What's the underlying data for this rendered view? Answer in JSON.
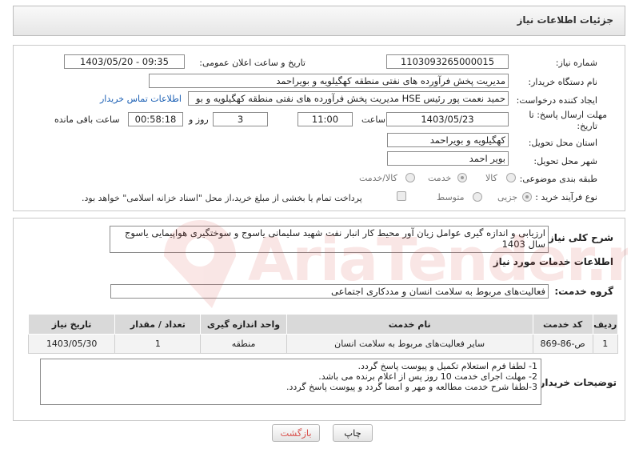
{
  "header": {
    "title": "جزئیات اطلاعات نیاز"
  },
  "fields": {
    "need_number_label": "شماره نیاز:",
    "need_number": "1103093265000015",
    "announce_label": "تاریخ و ساعت اعلان عمومی:",
    "announce_value": "1403/05/20 - 09:35",
    "buyer_org_label": "نام دستگاه خریدار:",
    "buyer_org": "مدیریت پخش فرآورده های نفتی منطقه کهگیلویه و بویراحمد",
    "creator_label": "ایجاد کننده درخواست:",
    "creator": "حمید نعمت پور رئیس HSE مدیریت پخش فرآورده های نفتی منطقه کهگیلویه و بو",
    "contact_link": "اطلاعات تماس خریدار",
    "deadline_label_1": "مهلت ارسال پاسخ: تا",
    "deadline_label_2": "تاریخ:",
    "deadline_date": "1403/05/23",
    "time_label": "ساعت",
    "deadline_time": "11:00",
    "days_value": "3",
    "days_label": "روز و",
    "remaining_time": "00:58:18",
    "remaining_label": "ساعت باقی مانده",
    "province_label": "استان محل تحویل:",
    "province": "کهگیلویه و بویراحمد",
    "city_label": "شهر محل تحویل:",
    "city": "بویر احمد",
    "category_label": "طبقه بندی موضوعی:",
    "category_options": [
      "کالا",
      "خدمت",
      "کالا/خدمت"
    ],
    "process_label": "نوع فرآیند خرید :",
    "process_options": [
      "جزیی",
      "متوسط"
    ],
    "payment_note": "پرداخت تمام یا بخشی از مبلغ خرید،از محل \"اسناد خزانه اسلامی\" خواهد بود."
  },
  "summary": {
    "label": "شرح کلی نیاز:",
    "text": "ارزیابی و اندازه گیری عوامل زیان آور محیط کار انبار نفت شهید سلیمانی یاسوج و سوختگیری هواپیمایی یاسوج سال 1403"
  },
  "services": {
    "section_title": "اطلاعات خدمات مورد نیاز",
    "group_label": "گروه خدمت:",
    "group_value": "فعالیت‌های مربوط به سلامت انسان و مددکاری اجتماعی",
    "columns": [
      "ردیف",
      "کد خدمت",
      "نام خدمت",
      "واحد اندازه گیری",
      "تعداد / مقدار",
      "تاریخ نیاز"
    ],
    "rows": [
      [
        "1",
        "ص-86-869",
        "سایر فعالیت‌های مربوط به سلامت انسان",
        "منطقه",
        "1",
        "1403/05/30"
      ]
    ]
  },
  "buyer_notes": {
    "label": "توضیحات خریدار:",
    "lines": [
      "1- لطفا فرم استعلام تکمیل و پیوست پاسخ گردد.",
      "2- مهلت اجرای خدمت 10 روز پس از اعلام برنده می باشد.",
      "3-لطفا شرح خدمت مطالعه و مهر و امضا گردد و پیوست پاسخ گردد."
    ]
  },
  "buttons": {
    "print": "چاپ",
    "back": "بازگشت"
  },
  "watermark": {
    "text": "AriaTender.neT"
  },
  "colors": {
    "link": "#1a5fb4",
    "back_text": "#d9534f",
    "watermark": "#d9534f"
  }
}
